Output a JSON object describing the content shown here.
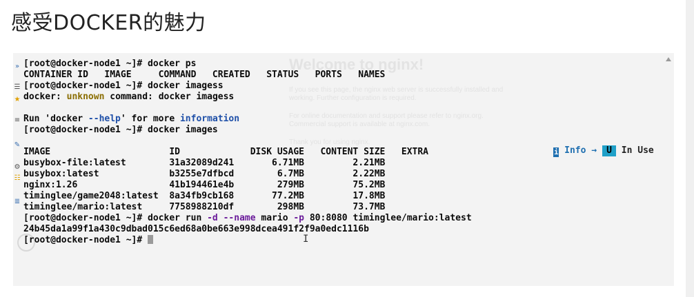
{
  "page": {
    "title": "感受DOCKER的魅力"
  },
  "terminal_lines": [
    [
      {
        "t": "[root@docker-node1 ~]# docker ps"
      }
    ],
    [
      {
        "t": "CONTAINER ID   IMAGE     COMMAND   CREATED   STATUS   PORTS   NAMES"
      }
    ],
    [
      {
        "t": "[root@docker-node1 ~]# docker imagess"
      }
    ],
    [
      {
        "t": "docker: "
      },
      {
        "t": "unknown",
        "c": "olive"
      },
      {
        "t": " command: docker imagess"
      }
    ],
    [
      {
        "t": ""
      }
    ],
    [
      {
        "t": "Run 'docker "
      },
      {
        "t": "--help",
        "c": "blue"
      },
      {
        "t": "' for more "
      },
      {
        "t": "information",
        "c": "blue"
      }
    ],
    [
      {
        "t": "[root@docker-node1 ~]# docker images"
      }
    ],
    [
      {
        "t": ""
      }
    ],
    [
      {
        "t": "IMAGE                      ID             DISK USAGE   CONTENT SIZE   EXTRA"
      }
    ],
    [
      {
        "t": "busybox-file:latest        31a32089d241       6.71MB         2.21MB"
      }
    ],
    [
      {
        "t": "busybox:latest             b3255e7dfbcd        6.7MB         2.22MB"
      }
    ],
    [
      {
        "t": "nginx:1.26                 41b194461e4b        279MB         75.2MB"
      }
    ],
    [
      {
        "t": "timinglee/game2048:latest  8a34fb9cb168       77.2MB         17.8MB"
      }
    ],
    [
      {
        "t": "timinglee/mario:latest     7758988210df        298MB         73.7MB"
      }
    ],
    [
      {
        "t": "[root@docker-node1 ~]# docker run "
      },
      {
        "t": "-d",
        "c": "purple"
      },
      {
        "t": " "
      },
      {
        "t": "--name",
        "c": "purple"
      },
      {
        "t": " mario "
      },
      {
        "t": "-p",
        "c": "purple"
      },
      {
        "t": " 80:8080 timinglee/mario:latest"
      }
    ],
    [
      {
        "t": "24b45da1a99f1a430c9dbad015c6ed68a0be663e998dcea491f2f9a0edc1116b"
      }
    ],
    [
      {
        "t": "[root@docker-node1 ~]# "
      }
    ]
  ],
  "status_bar": {
    "info_label": "Info →",
    "u_badge": "U",
    "in_use_label": "In Use"
  },
  "background_page": {
    "title": "Welcome to nginx!",
    "lines": [
      "If you see this page, the nginx web server is successfully installed and",
      "working. Further configuration is required.",
      "For online documentation and support please refer to nginx.org.",
      "Commercial support is available at nginx.com.",
      "Thank you for using nginx."
    ]
  },
  "colors": {
    "blue": "#1e4fa8",
    "olive": "#8a6d00",
    "purple": "#6a1b9a",
    "accent": "#1fa0c8"
  },
  "icons": [
    "expand-icon",
    "menu-icon",
    "star-icon",
    "list-icon",
    "edit-icon",
    "gear-icon",
    "play-icon"
  ]
}
